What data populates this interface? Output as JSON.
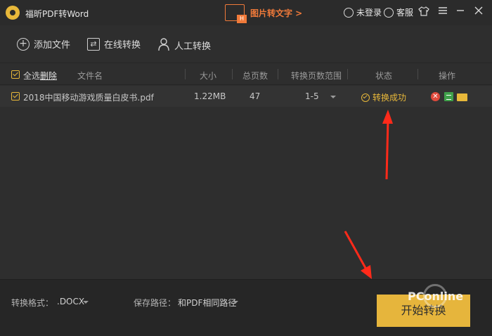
{
  "app": {
    "title": "福昕PDF转Word"
  },
  "promo": {
    "label": "图片转文字 >",
    "icon": "image-to-text-icon",
    "badge": "H"
  },
  "header": {
    "login_label": "未登录",
    "service_label": "客服"
  },
  "toolbar": {
    "add_file": "添加文件",
    "online_convert": "在线转换",
    "manual_convert": "人工转换"
  },
  "table": {
    "select_all": "全选",
    "delete": "删除",
    "columns": {
      "filename": "文件名",
      "size": "大小",
      "pages": "总页数",
      "range": "转换页数范围",
      "status": "状态",
      "actions": "操作"
    },
    "rows": [
      {
        "filename": "2018中国移动游戏质量白皮书.pdf",
        "size": "1.22MB",
        "pages": "47",
        "range": "1-5",
        "status": "转换成功"
      }
    ]
  },
  "footer": {
    "format_label": "转换格式：",
    "format_value": ".DOCX",
    "path_label": "保存路径：",
    "path_value": "和PDF相同路径",
    "start_button": "开始转换",
    "watermark": "PConline"
  },
  "colors": {
    "accent": "#e8b83a",
    "promo": "#f07a3a",
    "arrow": "#ff2a1a",
    "background": "#2e2e2e"
  }
}
